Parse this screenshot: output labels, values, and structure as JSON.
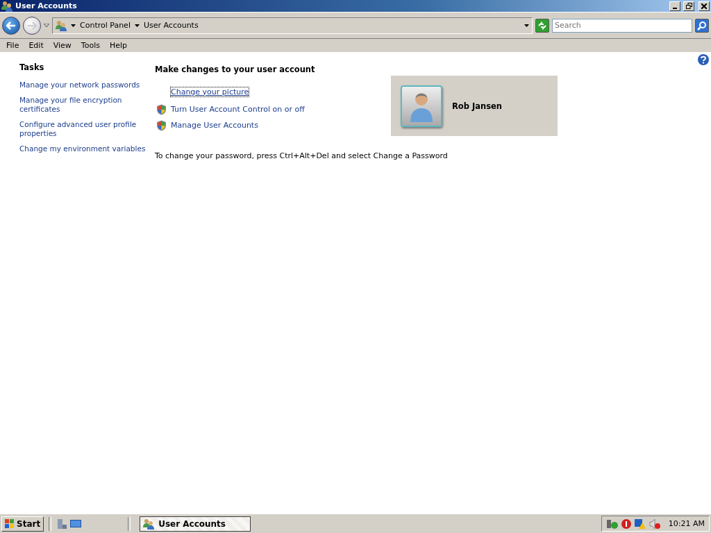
{
  "window": {
    "title": "User Accounts"
  },
  "address_bar": {
    "breadcrumbs": [
      "Control Panel",
      "User Accounts"
    ],
    "search": {
      "placeholder": "Search"
    }
  },
  "menu": [
    "File",
    "Edit",
    "View",
    "Tools",
    "Help"
  ],
  "tasks": {
    "title": "Tasks",
    "links": [
      "Manage your network passwords",
      "Manage your file encryption certificates",
      "Configure advanced user profile properties",
      "Change my environment variables"
    ]
  },
  "main": {
    "heading": "Make changes to your user account",
    "links": [
      {
        "label": "Change your picture",
        "shield": false,
        "focused": true
      },
      {
        "label": "Turn User Account Control on or off",
        "shield": true,
        "focused": false
      },
      {
        "label": "Manage User Accounts",
        "shield": true,
        "focused": false
      }
    ],
    "note": "To change your password, press Ctrl+Alt+Del and select Change a Password"
  },
  "account": {
    "name": "Rob Jansen"
  },
  "taskbar": {
    "start": "Start",
    "tasks": [
      {
        "label": "User Accounts",
        "selected": true
      }
    ],
    "clock": "10:21 AM"
  }
}
